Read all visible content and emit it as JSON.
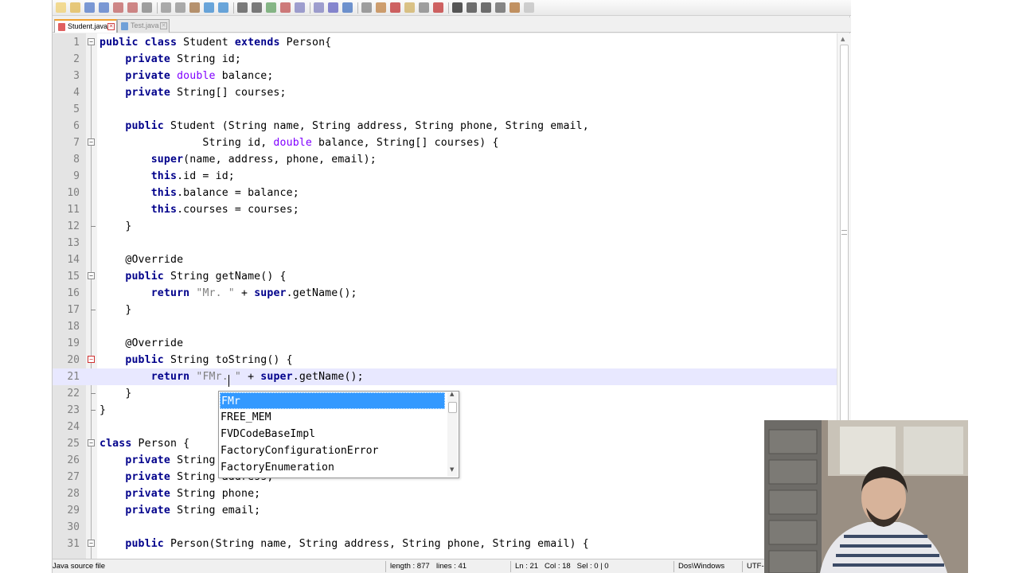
{
  "toolbar": {
    "icons": [
      "new-file-icon",
      "open-file-icon",
      "save-icon",
      "save-all-icon",
      "close-icon",
      "close-all-icon",
      "print-icon",
      "cut-icon",
      "copy-icon",
      "paste-icon",
      "undo-icon",
      "redo-icon",
      "find-icon",
      "replace-icon",
      "zoom-in-icon",
      "zoom-out-icon",
      "sync-vertical-icon",
      "sync-horizontal-icon",
      "word-wrap-icon",
      "show-all-chars-icon",
      "indent-guide-icon",
      "doc-map-icon",
      "function-list-icon",
      "folder-workspace-icon",
      "monitoring-icon",
      "record-macro-icon",
      "stop-recording-icon",
      "play-macro-icon",
      "play-multiple-icon",
      "save-macro-icon",
      "spellcheck-icon",
      "plugin-icon"
    ]
  },
  "tabs": [
    {
      "label": "Student.java",
      "active": true
    },
    {
      "label": "Test.java",
      "active": false
    }
  ],
  "editor": {
    "current_line": 21,
    "lines": [
      {
        "n": "1",
        "fold": "open",
        "tokens": [
          [
            "kw",
            "public"
          ],
          [
            "t",
            " "
          ],
          [
            "kw",
            "class"
          ],
          [
            "t",
            " Student "
          ],
          [
            "kw",
            "extends"
          ],
          [
            "t",
            " Person{"
          ]
        ]
      },
      {
        "n": "2",
        "tokens": [
          [
            "t",
            "    "
          ],
          [
            "kw",
            "private"
          ],
          [
            "t",
            " String id;"
          ]
        ]
      },
      {
        "n": "3",
        "tokens": [
          [
            "t",
            "    "
          ],
          [
            "kw",
            "private"
          ],
          [
            "t",
            " "
          ],
          [
            "ty",
            "double"
          ],
          [
            "t",
            " balance;"
          ]
        ]
      },
      {
        "n": "4",
        "tokens": [
          [
            "t",
            "    "
          ],
          [
            "kw",
            "private"
          ],
          [
            "t",
            " String[] courses;"
          ]
        ]
      },
      {
        "n": "5",
        "tokens": []
      },
      {
        "n": "6",
        "tokens": [
          [
            "t",
            "    "
          ],
          [
            "kw",
            "public"
          ],
          [
            "t",
            " Student (String name, String address, String phone, String email,"
          ]
        ]
      },
      {
        "n": "7",
        "fold": "open",
        "tokens": [
          [
            "t",
            "                String id, "
          ],
          [
            "ty",
            "double"
          ],
          [
            "t",
            " balance, String[] courses) {"
          ]
        ]
      },
      {
        "n": "8",
        "tokens": [
          [
            "t",
            "        "
          ],
          [
            "kw",
            "super"
          ],
          [
            "t",
            "(name, address, phone, email);"
          ]
        ]
      },
      {
        "n": "9",
        "tokens": [
          [
            "t",
            "        "
          ],
          [
            "kw",
            "this"
          ],
          [
            "t",
            ".id = id;"
          ]
        ]
      },
      {
        "n": "10",
        "tokens": [
          [
            "t",
            "        "
          ],
          [
            "kw",
            "this"
          ],
          [
            "t",
            ".balance = balance;"
          ]
        ]
      },
      {
        "n": "11",
        "tokens": [
          [
            "t",
            "        "
          ],
          [
            "kw",
            "this"
          ],
          [
            "t",
            ".courses = courses;"
          ]
        ]
      },
      {
        "n": "12",
        "fold": "end",
        "tokens": [
          [
            "t",
            "    }"
          ]
        ]
      },
      {
        "n": "13",
        "tokens": []
      },
      {
        "n": "14",
        "tokens": [
          [
            "t",
            "    @Override"
          ]
        ]
      },
      {
        "n": "15",
        "fold": "open",
        "tokens": [
          [
            "t",
            "    "
          ],
          [
            "kw",
            "public"
          ],
          [
            "t",
            " String getName() {"
          ]
        ]
      },
      {
        "n": "16",
        "tokens": [
          [
            "t",
            "        "
          ],
          [
            "kw",
            "return"
          ],
          [
            "t",
            " "
          ],
          [
            "st",
            "\"Mr. \""
          ],
          [
            "t",
            " + "
          ],
          [
            "kw",
            "super"
          ],
          [
            "t",
            ".getName();"
          ]
        ]
      },
      {
        "n": "17",
        "fold": "end",
        "tokens": [
          [
            "t",
            "    }"
          ]
        ]
      },
      {
        "n": "18",
        "tokens": []
      },
      {
        "n": "19",
        "tokens": [
          [
            "t",
            "    @Override"
          ]
        ]
      },
      {
        "n": "20",
        "fold": "open-red",
        "tokens": [
          [
            "t",
            "    "
          ],
          [
            "kw",
            "public"
          ],
          [
            "t",
            " String toString() {"
          ]
        ]
      },
      {
        "n": "21",
        "tokens": [
          [
            "t",
            "        "
          ],
          [
            "kw",
            "return"
          ],
          [
            "t",
            " "
          ],
          [
            "st",
            "\"FMr. \""
          ],
          [
            "t",
            " + "
          ],
          [
            "kw",
            "super"
          ],
          [
            "t",
            ".getName();"
          ]
        ]
      },
      {
        "n": "22",
        "fold": "end",
        "tokens": [
          [
            "t",
            "    }"
          ]
        ]
      },
      {
        "n": "23",
        "fold": "end",
        "tokens": [
          [
            "t",
            "}"
          ]
        ]
      },
      {
        "n": "24",
        "tokens": []
      },
      {
        "n": "25",
        "fold": "open",
        "tokens": [
          [
            "kw",
            "class"
          ],
          [
            "t",
            " Person {"
          ]
        ]
      },
      {
        "n": "26",
        "tokens": [
          [
            "t",
            "    "
          ],
          [
            "kw",
            "private"
          ],
          [
            "t",
            " String name;"
          ]
        ]
      },
      {
        "n": "27",
        "tokens": [
          [
            "t",
            "    "
          ],
          [
            "kw",
            "private"
          ],
          [
            "t",
            " String address;"
          ]
        ]
      },
      {
        "n": "28",
        "tokens": [
          [
            "t",
            "    "
          ],
          [
            "kw",
            "private"
          ],
          [
            "t",
            " String phone;"
          ]
        ]
      },
      {
        "n": "29",
        "tokens": [
          [
            "t",
            "    "
          ],
          [
            "kw",
            "private"
          ],
          [
            "t",
            " String email;"
          ]
        ]
      },
      {
        "n": "30",
        "tokens": []
      },
      {
        "n": "31",
        "fold": "open",
        "tokens": [
          [
            "t",
            "    "
          ],
          [
            "kw",
            "public"
          ],
          [
            "t",
            " Person(String name, String address, String phone, String email) {"
          ]
        ]
      }
    ]
  },
  "autocomplete": {
    "items": [
      "FMr",
      "FREE_MEM",
      "FVDCodeBaseImpl",
      "FactoryConfigurationError",
      "FactoryEnumeration"
    ],
    "selected_index": 0
  },
  "statusbar": {
    "language": "Java source file",
    "length": "length : 877",
    "lines": "lines : 41",
    "position": "Ln : 21   Col : 18   Sel : 0 | 0",
    "eol": "Dos\\Windows",
    "encoding": "UTF-8"
  },
  "colors": {
    "keyword": "#00008b",
    "type": "#8000ff",
    "string": "#808080",
    "current_line": "#e8e8ff",
    "selection": "#3399ff"
  }
}
